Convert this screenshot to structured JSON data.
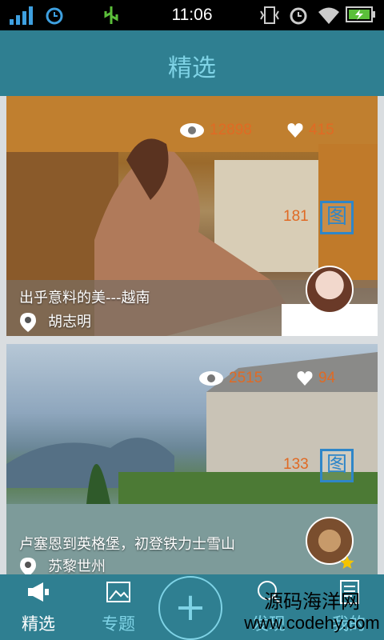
{
  "status_bar": {
    "time": "11:06",
    "icons": [
      "signal-icon",
      "alarm-icon",
      "usb-icon",
      "vibrate-icon",
      "alarm-icon",
      "wifi-icon",
      "battery-charging-icon"
    ]
  },
  "header": {
    "title": "精选"
  },
  "cards": [
    {
      "views": "12898",
      "likes": "415",
      "image_count": "181",
      "image_badge": "图",
      "caption": "出乎意料的美---越南",
      "author": "胡志明"
    },
    {
      "views": "2515",
      "likes": "94",
      "image_count": "133",
      "image_badge": "图",
      "caption": "卢塞恩到英格堡，初登铁力士雪山",
      "author": "苏黎世州"
    }
  ],
  "tabbar": {
    "tabs": [
      {
        "label": "精选",
        "icon": "megaphone-icon",
        "active": true
      },
      {
        "label": "专题",
        "icon": "image-icon",
        "active": false
      },
      {
        "label": "+",
        "icon": "plus-icon",
        "active": false
      },
      {
        "label": "发现",
        "icon": "search-icon",
        "active": false
      },
      {
        "label": "我的",
        "icon": "document-icon",
        "active": false
      }
    ]
  },
  "watermark": {
    "line1": "源码海洋网",
    "line2": "www.codehy.com"
  },
  "colors": {
    "accent": "#2f7f91",
    "highlight": "#7fd3e6",
    "stat": "#e06a24",
    "badge": "#2f86c8"
  }
}
